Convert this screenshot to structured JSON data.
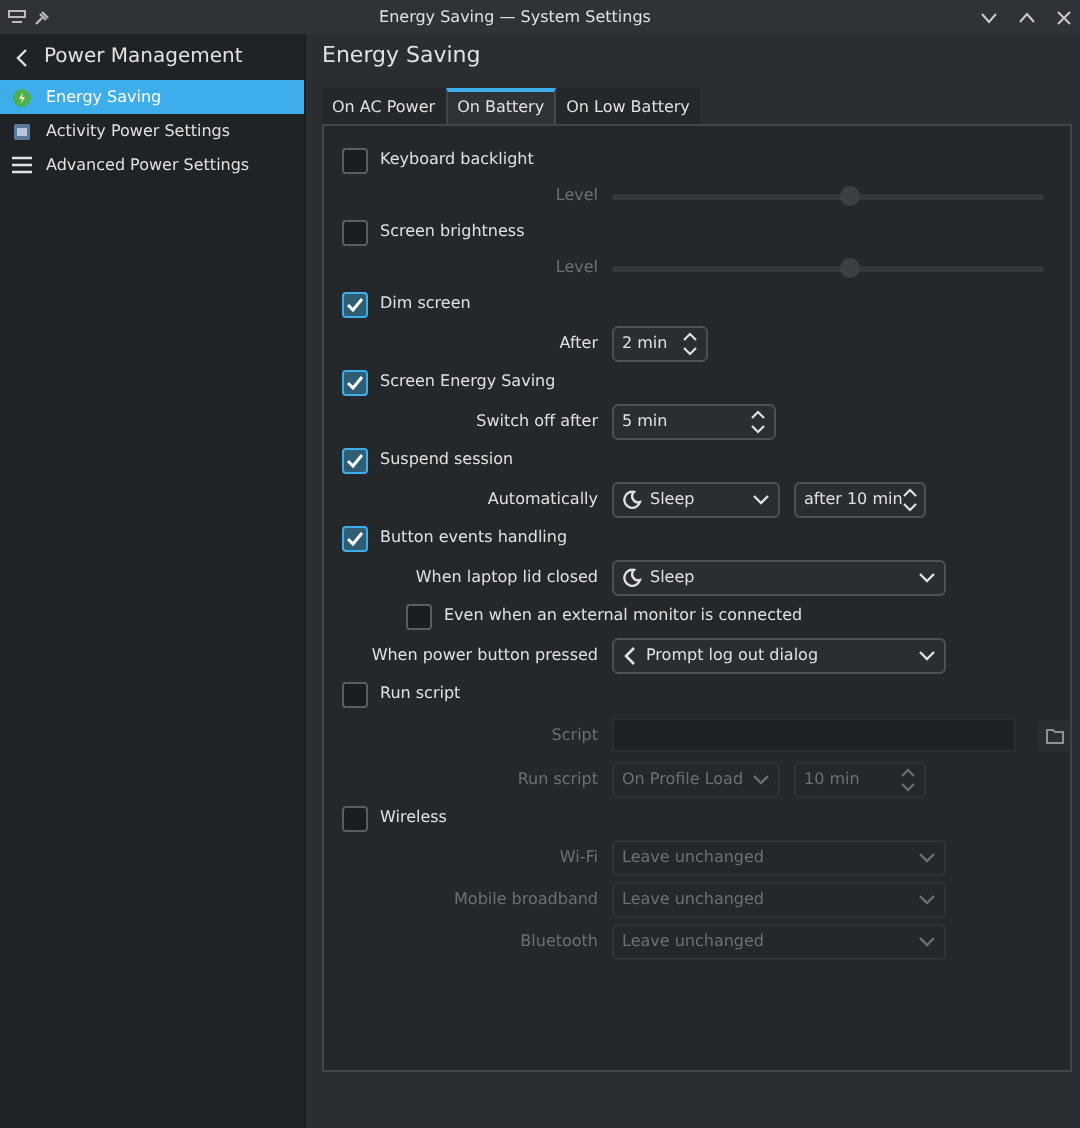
{
  "window": {
    "title": "Energy Saving — System Settings"
  },
  "sidebar": {
    "title": "Power Management",
    "items": [
      {
        "label": "Energy Saving",
        "selected": true
      },
      {
        "label": "Activity Power Settings",
        "selected": false
      },
      {
        "label": "Advanced Power Settings",
        "selected": false
      }
    ]
  },
  "page_title": "Energy Saving",
  "tabs": [
    {
      "label": "On AC Power",
      "selected": false
    },
    {
      "label": "On Battery",
      "selected": true
    },
    {
      "label": "On Low Battery",
      "selected": false
    }
  ],
  "rows": [
    {
      "kind": "checkbox",
      "label": "Keyboard backlight",
      "checked": false
    },
    {
      "kind": "slider",
      "label": "Level",
      "level": 0.55,
      "disabled": true
    },
    {
      "kind": "checkbox",
      "label": "Screen brightness",
      "checked": false
    },
    {
      "kind": "slider",
      "label": "Level",
      "level": 0.55,
      "disabled": true
    },
    {
      "kind": "checkbox",
      "label": "Dim screen",
      "checked": true
    },
    {
      "kind": "spin",
      "label": "After",
      "value": "2 min",
      "disabled": false
    },
    {
      "kind": "checkbox",
      "label": "Screen Energy Saving",
      "checked": true
    },
    {
      "kind": "spin",
      "label": "Switch off after",
      "value": "5 min",
      "disabled": false
    },
    {
      "kind": "checkbox",
      "label": "Suspend session",
      "checked": true
    },
    {
      "kind": "combo_spin",
      "label": "Automatically",
      "value": "Sleep",
      "spin": "after 10 min",
      "disabled": false
    },
    {
      "kind": "checkbox",
      "label": "Button events handling",
      "checked": true
    },
    {
      "kind": "combo",
      "label": "When laptop lid closed",
      "value": "Sleep",
      "disabled": false
    },
    {
      "kind": "subcheck",
      "label": "Even when an external monitor is connected",
      "checked": false
    },
    {
      "kind": "combo",
      "label": "When power button pressed",
      "value": "Prompt log out dialog",
      "disabled": false
    },
    {
      "kind": "checkbox",
      "label": "Run script",
      "checked": false
    },
    {
      "kind": "file",
      "label": "Script",
      "disabled": true
    },
    {
      "kind": "combo_spin",
      "label": "Run script",
      "value": "On Profile Load",
      "spin": "10 min",
      "disabled": true
    },
    {
      "kind": "checkbox",
      "label": "Wireless",
      "checked": false
    },
    {
      "kind": "combo",
      "label": "Wi-Fi",
      "value": "Leave unchanged",
      "disabled": true
    },
    {
      "kind": "combo",
      "label": "Mobile broadband",
      "value": "Leave unchanged",
      "disabled": true
    },
    {
      "kind": "combo",
      "label": "Bluetooth",
      "value": "Leave unchanged",
      "disabled": true
    }
  ]
}
